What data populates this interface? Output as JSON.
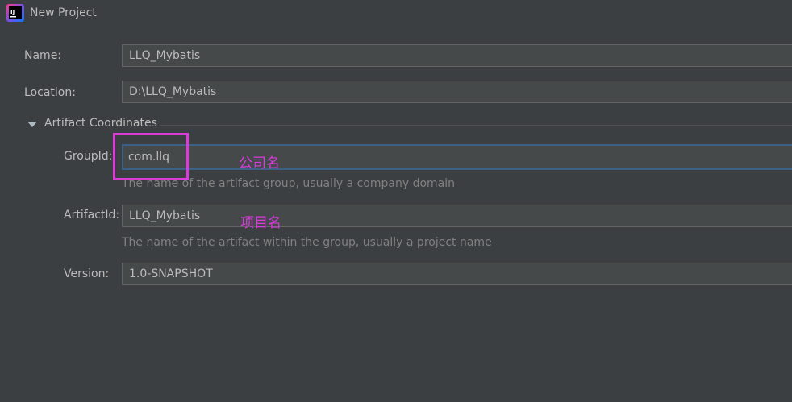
{
  "window": {
    "title": "New Project",
    "icon_text": "IJ"
  },
  "form": {
    "name_label": "Name:",
    "name_value": "LLQ_Mybatis",
    "location_label": "Location:",
    "location_value": "D:\\LLQ_Mybatis",
    "section_title": "Artifact Coordinates",
    "groupid_label": "GroupId:",
    "groupid_value": "com.llq",
    "groupid_hint": "The name of the artifact group, usually a company domain",
    "artifactid_label": "ArtifactId:",
    "artifactid_value": "LLQ_Mybatis",
    "artifactid_hint": "The name of the artifact within the group, usually a project name",
    "version_label": "Version:",
    "version_value": "1.0-SNAPSHOT"
  },
  "annotations": {
    "company_name": "公司名",
    "project_name": "项目名",
    "color": "#d93cd8"
  },
  "colors": {
    "background": "#3c3f41",
    "field_bg": "#45494a",
    "focus_border": "#3d6185"
  }
}
